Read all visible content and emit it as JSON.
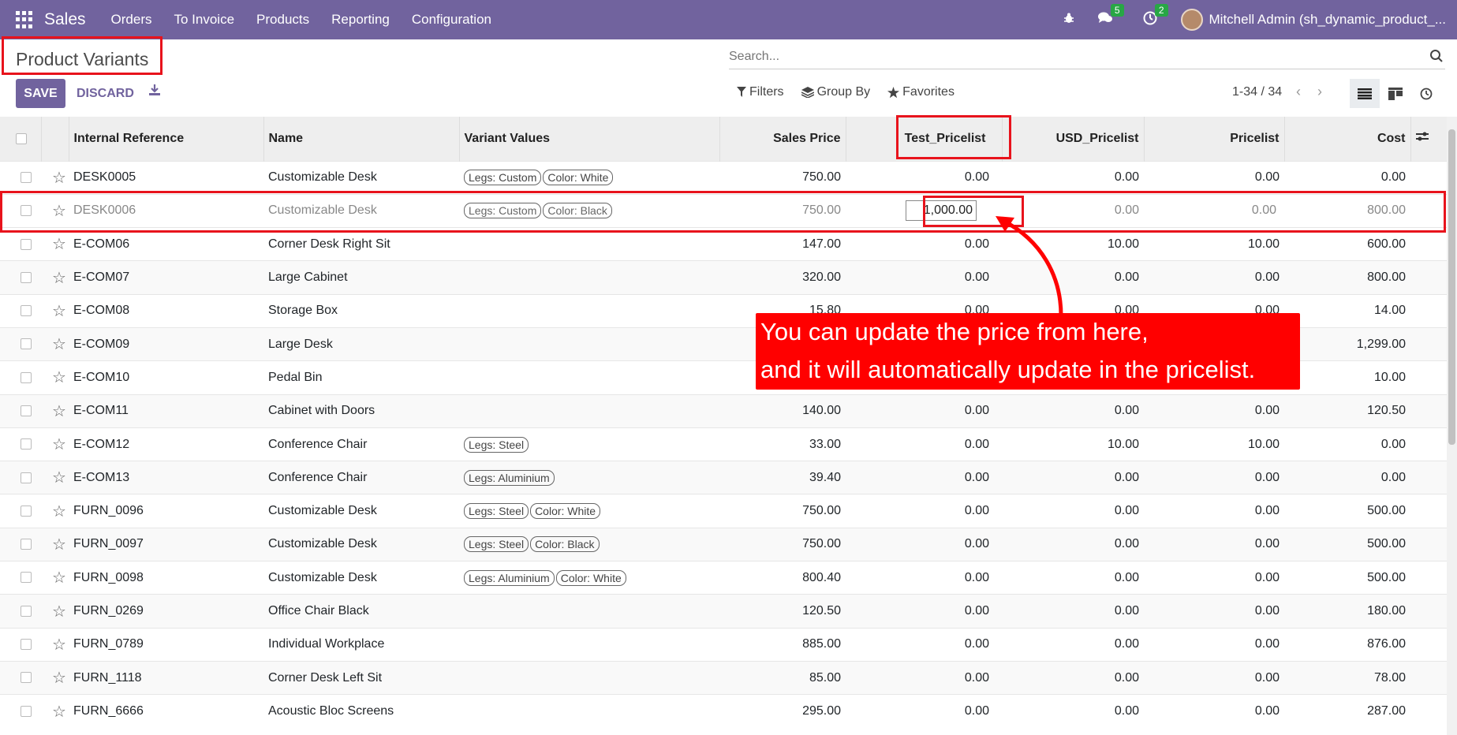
{
  "navbar": {
    "app_name": "Sales",
    "menu": [
      "Orders",
      "To Invoice",
      "Products",
      "Reporting",
      "Configuration"
    ],
    "messages_count": "5",
    "activities_count": "2",
    "user": "Mitchell Admin (sh_dynamic_product_..."
  },
  "control_panel": {
    "title": "Product Variants",
    "search_placeholder": "Search...",
    "save_label": "SAVE",
    "discard_label": "DISCARD",
    "filters_label": "Filters",
    "groupby_label": "Group By",
    "favorites_label": "Favorites",
    "pager": "1-34 / 34"
  },
  "table": {
    "columns": [
      "Internal Reference",
      "Name",
      "Variant Values",
      "Sales Price",
      "Test_Pricelist",
      "USD_Pricelist",
      "Pricelist",
      "Cost"
    ],
    "rows": [
      {
        "ref": "DESK0005",
        "name": "Customizable Desk",
        "tags": [
          "Legs: Custom",
          "Color: White"
        ],
        "price": "750.00",
        "test": "0.00",
        "usd": "0.00",
        "pl": "0.00",
        "cost": "0.00"
      },
      {
        "ref": "DESK0006",
        "name": "Customizable Desk",
        "tags": [
          "Legs: Custom",
          "Color: Black"
        ],
        "price": "750.00",
        "test": "1,000.00",
        "usd": "0.00",
        "pl": "0.00",
        "cost": "800.00"
      },
      {
        "ref": "E-COM06",
        "name": "Corner Desk Right Sit",
        "tags": [],
        "price": "147.00",
        "test": "0.00",
        "usd": "10.00",
        "pl": "10.00",
        "cost": "600.00"
      },
      {
        "ref": "E-COM07",
        "name": "Large Cabinet",
        "tags": [],
        "price": "320.00",
        "test": "0.00",
        "usd": "0.00",
        "pl": "0.00",
        "cost": "800.00"
      },
      {
        "ref": "E-COM08",
        "name": "Storage Box",
        "tags": [],
        "price": "15.80",
        "test": "0.00",
        "usd": "0.00",
        "pl": "0.00",
        "cost": "14.00"
      },
      {
        "ref": "E-COM09",
        "name": "Large Desk",
        "tags": [],
        "price": "",
        "test": "",
        "usd": "",
        "pl": "",
        "cost": "1,299.00"
      },
      {
        "ref": "E-COM10",
        "name": "Pedal Bin",
        "tags": [],
        "price": "",
        "test": "",
        "usd": "",
        "pl": "",
        "cost": "10.00"
      },
      {
        "ref": "E-COM11",
        "name": "Cabinet with Doors",
        "tags": [],
        "price": "140.00",
        "test": "0.00",
        "usd": "0.00",
        "pl": "0.00",
        "cost": "120.50"
      },
      {
        "ref": "E-COM12",
        "name": "Conference Chair",
        "tags": [
          "Legs: Steel"
        ],
        "price": "33.00",
        "test": "0.00",
        "usd": "10.00",
        "pl": "10.00",
        "cost": "0.00"
      },
      {
        "ref": "E-COM13",
        "name": "Conference Chair",
        "tags": [
          "Legs: Aluminium"
        ],
        "price": "39.40",
        "test": "0.00",
        "usd": "0.00",
        "pl": "0.00",
        "cost": "0.00"
      },
      {
        "ref": "FURN_0096",
        "name": "Customizable Desk",
        "tags": [
          "Legs: Steel",
          "Color: White"
        ],
        "price": "750.00",
        "test": "0.00",
        "usd": "0.00",
        "pl": "0.00",
        "cost": "500.00"
      },
      {
        "ref": "FURN_0097",
        "name": "Customizable Desk",
        "tags": [
          "Legs: Steel",
          "Color: Black"
        ],
        "price": "750.00",
        "test": "0.00",
        "usd": "0.00",
        "pl": "0.00",
        "cost": "500.00"
      },
      {
        "ref": "FURN_0098",
        "name": "Customizable Desk",
        "tags": [
          "Legs: Aluminium",
          "Color: White"
        ],
        "price": "800.40",
        "test": "0.00",
        "usd": "0.00",
        "pl": "0.00",
        "cost": "500.00"
      },
      {
        "ref": "FURN_0269",
        "name": "Office Chair Black",
        "tags": [],
        "price": "120.50",
        "test": "0.00",
        "usd": "0.00",
        "pl": "0.00",
        "cost": "180.00"
      },
      {
        "ref": "FURN_0789",
        "name": "Individual Workplace",
        "tags": [],
        "price": "885.00",
        "test": "0.00",
        "usd": "0.00",
        "pl": "0.00",
        "cost": "876.00"
      },
      {
        "ref": "FURN_1118",
        "name": "Corner Desk Left Sit",
        "tags": [],
        "price": "85.00",
        "test": "0.00",
        "usd": "0.00",
        "pl": "0.00",
        "cost": "78.00"
      },
      {
        "ref": "FURN_6666",
        "name": "Acoustic Bloc Screens",
        "tags": [],
        "price": "295.00",
        "test": "0.00",
        "usd": "0.00",
        "pl": "0.00",
        "cost": "287.00"
      }
    ]
  },
  "annotation": {
    "line1": "You can update the price from here,",
    "line2": "and it will automatically update in the pricelist."
  },
  "colors": {
    "brand": "#71639e",
    "highlight": "#e8131c",
    "badge": "#28a745"
  }
}
